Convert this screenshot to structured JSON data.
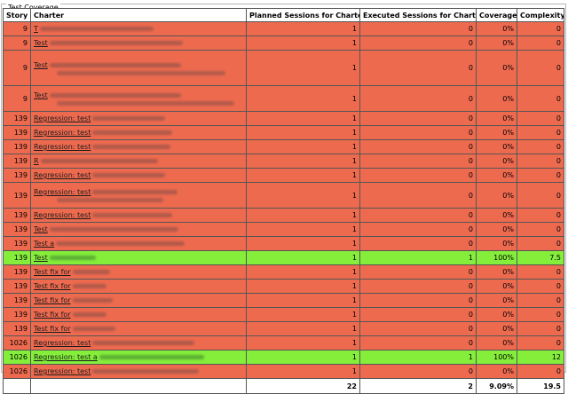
{
  "fieldset": {
    "legend": "Test Coverage"
  },
  "columns": [
    "Story",
    "Charter",
    "Planned Sessions for Charter",
    "Executed Sessions for Charter",
    "Coverage",
    "Complexity"
  ],
  "rows": [
    {
      "story": "9",
      "charter": "T",
      "planned": "1",
      "executed": "0",
      "coverage": "0%",
      "complexity": "0",
      "status": "red"
    },
    {
      "story": "9",
      "charter": "Test",
      "planned": "1",
      "executed": "0",
      "coverage": "0%",
      "complexity": "0",
      "status": "red"
    },
    {
      "story": "9",
      "charter": "Test",
      "planned": "1",
      "executed": "0",
      "coverage": "0%",
      "complexity": "0",
      "status": "red"
    },
    {
      "story": "9",
      "charter": "Test",
      "planned": "1",
      "executed": "0",
      "coverage": "0%",
      "complexity": "0",
      "status": "red"
    },
    {
      "story": "139",
      "charter": "Regression: test",
      "planned": "1",
      "executed": "0",
      "coverage": "0%",
      "complexity": "0",
      "status": "red"
    },
    {
      "story": "139",
      "charter": "Regression: test",
      "planned": "1",
      "executed": "0",
      "coverage": "0%",
      "complexity": "0",
      "status": "red"
    },
    {
      "story": "139",
      "charter": "Regression: test",
      "planned": "1",
      "executed": "0",
      "coverage": "0%",
      "complexity": "0",
      "status": "red"
    },
    {
      "story": "139",
      "charter": "R",
      "planned": "1",
      "executed": "0",
      "coverage": "0%",
      "complexity": "0",
      "status": "red"
    },
    {
      "story": "139",
      "charter": "Regression: test",
      "planned": "1",
      "executed": "0",
      "coverage": "0%",
      "complexity": "0",
      "status": "red"
    },
    {
      "story": "139",
      "charter": "Regression: test",
      "planned": "1",
      "executed": "0",
      "coverage": "0%",
      "complexity": "0",
      "status": "red"
    },
    {
      "story": "139",
      "charter": "Regression: test",
      "planned": "1",
      "executed": "0",
      "coverage": "0%",
      "complexity": "0",
      "status": "red"
    },
    {
      "story": "139",
      "charter": "Test",
      "planned": "1",
      "executed": "0",
      "coverage": "0%",
      "complexity": "0",
      "status": "red"
    },
    {
      "story": "139",
      "charter": "Test a",
      "planned": "1",
      "executed": "0",
      "coverage": "0%",
      "complexity": "0",
      "status": "red"
    },
    {
      "story": "139",
      "charter": "Test",
      "planned": "1",
      "executed": "1",
      "coverage": "100%",
      "complexity": "7.5",
      "status": "green"
    },
    {
      "story": "139",
      "charter": "Test fix for",
      "planned": "1",
      "executed": "0",
      "coverage": "0%",
      "complexity": "0",
      "status": "red"
    },
    {
      "story": "139",
      "charter": "Test fix for",
      "planned": "1",
      "executed": "0",
      "coverage": "0%",
      "complexity": "0",
      "status": "red"
    },
    {
      "story": "139",
      "charter": "Test fix for",
      "planned": "1",
      "executed": "0",
      "coverage": "0%",
      "complexity": "0",
      "status": "red"
    },
    {
      "story": "139",
      "charter": "Test fix for",
      "planned": "1",
      "executed": "0",
      "coverage": "0%",
      "complexity": "0",
      "status": "red"
    },
    {
      "story": "139",
      "charter": "Test fix for",
      "planned": "1",
      "executed": "0",
      "coverage": "0%",
      "complexity": "0",
      "status": "red"
    },
    {
      "story": "1026",
      "charter": "Regression: test",
      "planned": "1",
      "executed": "0",
      "coverage": "0%",
      "complexity": "0",
      "status": "red"
    },
    {
      "story": "1026",
      "charter": "Regression: test a",
      "planned": "1",
      "executed": "1",
      "coverage": "100%",
      "complexity": "12",
      "status": "green"
    },
    {
      "story": "1026",
      "charter": "Regression: test",
      "planned": "1",
      "executed": "0",
      "coverage": "0%",
      "complexity": "0",
      "status": "red"
    }
  ],
  "totals": {
    "planned": "22",
    "executed": "2",
    "coverage": "9.09%",
    "complexity": "19.5"
  },
  "colors": {
    "not_covered": "#ee6a4f",
    "covered": "#84ee3b"
  }
}
